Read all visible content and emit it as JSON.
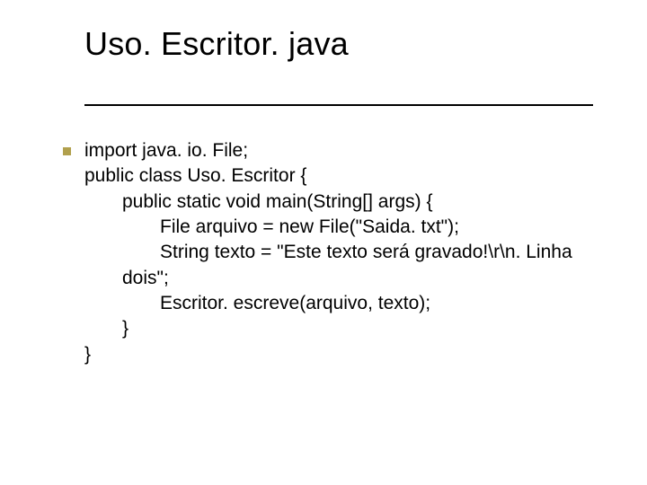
{
  "title": "Uso. Escritor. java",
  "code": {
    "line0": "import java. io. File;",
    "line1": "public class Uso. Escritor {",
    "line2": "public static void main(String[] args) {",
    "line3": "File arquivo = new File(\"Saida. txt\");",
    "line4": "String texto = \"Este texto será gravado!\\r\\n. Linha",
    "line5": "dois\";",
    "line6": "Escritor. escreve(arquivo, texto);",
    "line7": "}",
    "line8": "}"
  }
}
